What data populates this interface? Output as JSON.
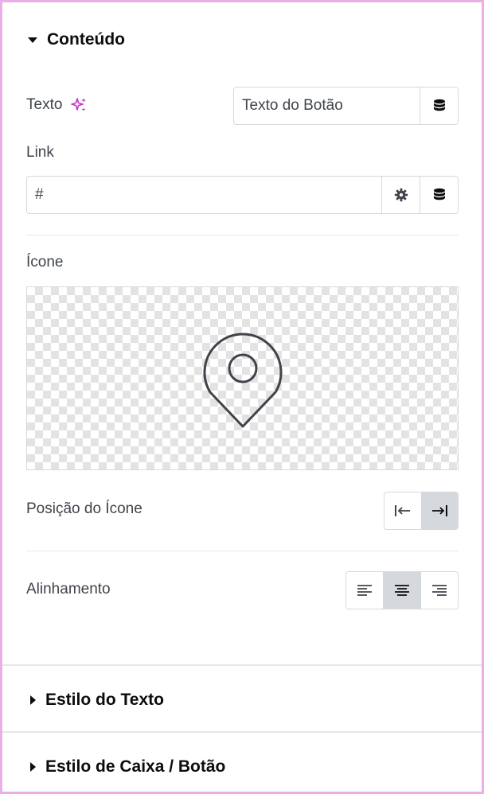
{
  "sections": {
    "content": {
      "title": "Conteúdo",
      "expanded": true
    },
    "text_style": {
      "title": "Estilo do Texto",
      "expanded": false
    },
    "box_style": {
      "title": "Estilo de Caixa / Botão",
      "expanded": false
    }
  },
  "fields": {
    "text": {
      "label": "Texto",
      "value": "Texto do Botão",
      "ai_icon": "sparkle-icon",
      "dynamic_icon": "database-icon"
    },
    "link": {
      "label": "Link",
      "value": "#",
      "settings_icon": "gear-icon",
      "dynamic_icon": "database-icon"
    },
    "icon": {
      "label": "Ícone",
      "selected_icon": "map-pin-icon"
    },
    "icon_position": {
      "label": "Posição do Ícone",
      "options": [
        "before",
        "after"
      ],
      "selected": "after"
    },
    "alignment": {
      "label": "Alinhamento",
      "options": [
        "left",
        "center",
        "right"
      ],
      "selected": "center"
    }
  },
  "colors": {
    "frame_border": "#eab0e5",
    "ai_accent": "#c036c5",
    "active_button": "#d5d8dc",
    "text": "#3f444b",
    "heading": "#0c0d0e"
  }
}
